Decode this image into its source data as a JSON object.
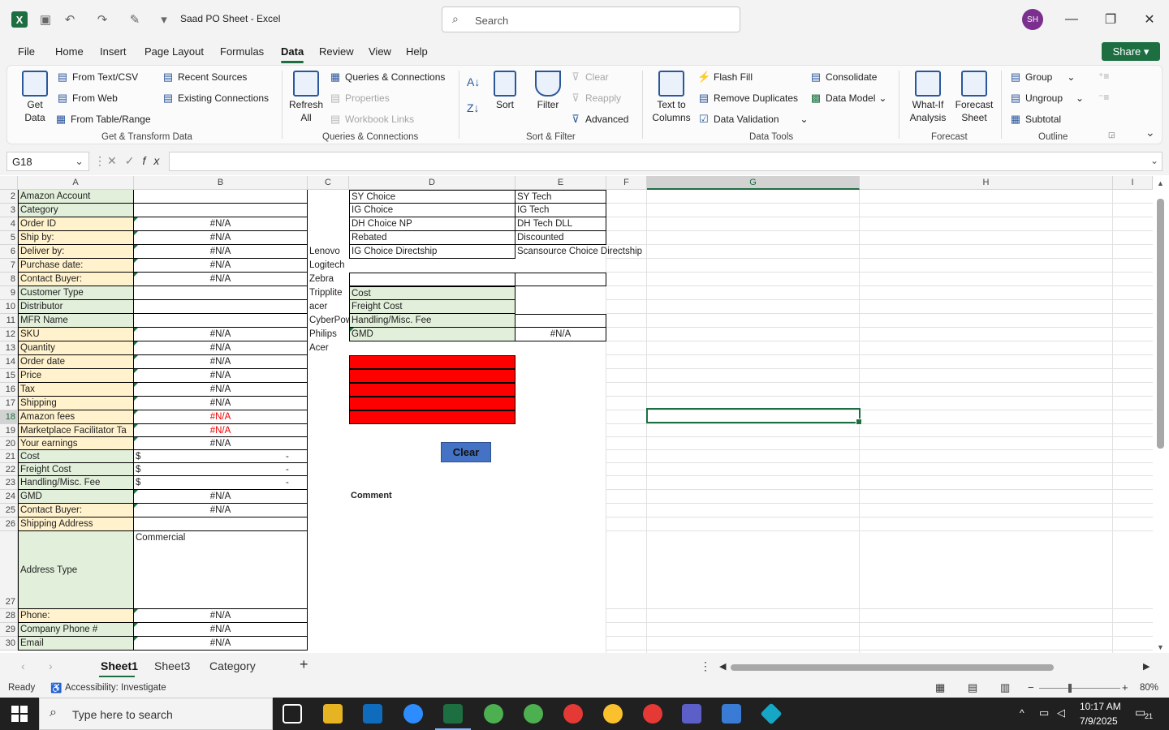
{
  "titlebar": {
    "doc_title": "Saad PO Sheet  -  Excel",
    "search_placeholder": "Search",
    "avatar": "SH"
  },
  "menu": [
    "File",
    "Home",
    "Insert",
    "Page Layout",
    "Formulas",
    "Data",
    "Review",
    "View",
    "Help"
  ],
  "active_menu": "Data",
  "share_label": "Share",
  "ribbon": {
    "get_data": "Get\nData",
    "from_text_csv": "From Text/CSV",
    "from_web": "From Web",
    "from_table_range": "From Table/Range",
    "recent_sources": "Recent Sources",
    "existing_connections": "Existing Connections",
    "group_get_transform": "Get & Transform Data",
    "refresh_all": "Refresh\nAll",
    "queries_connections": "Queries & Connections",
    "properties": "Properties",
    "workbook_links": "Workbook Links",
    "group_queries": "Queries & Connections",
    "sort": "Sort",
    "filter": "Filter",
    "clear": "Clear",
    "reapply": "Reapply",
    "advanced": "Advanced",
    "group_sort_filter": "Sort & Filter",
    "text_to_columns": "Text to\nColumns",
    "flash_fill": "Flash Fill",
    "remove_duplicates": "Remove Duplicates",
    "data_validation": "Data Validation",
    "consolidate": "Consolidate",
    "data_model": "Data Model",
    "group_data_tools": "Data Tools",
    "what_if": "What-If\nAnalysis",
    "forecast_sheet": "Forecast\nSheet",
    "group_forecast": "Forecast",
    "group_btn": "Group",
    "ungroup": "Ungroup",
    "subtotal": "Subtotal",
    "group_outline": "Outline"
  },
  "name_box": "G18",
  "columns": [
    "A",
    "B",
    "C",
    "D",
    "E",
    "F",
    "G",
    "H",
    "I"
  ],
  "selected_column": "G",
  "selected_row": "18",
  "rows_a": [
    {
      "r": "2",
      "label": "Amazon Account",
      "fill": "g",
      "b": ""
    },
    {
      "r": "3",
      "label": "Category",
      "fill": "g",
      "b": ""
    },
    {
      "r": "4",
      "label": "Order ID",
      "fill": "y",
      "b": "#N/A"
    },
    {
      "r": "5",
      "label": "Ship by:",
      "fill": "y",
      "b": "#N/A"
    },
    {
      "r": "6",
      "label": "Deliver by:",
      "fill": "y",
      "b": "#N/A"
    },
    {
      "r": "7",
      "label": "Purchase date:",
      "fill": "y",
      "b": "#N/A"
    },
    {
      "r": "8",
      "label": "Contact Buyer:",
      "fill": "y",
      "b": "#N/A"
    },
    {
      "r": "9",
      "label": "Customer Type",
      "fill": "g",
      "b": ""
    },
    {
      "r": "10",
      "label": "Distributor",
      "fill": "g",
      "b": ""
    },
    {
      "r": "11",
      "label": "MFR Name",
      "fill": "g",
      "b": ""
    },
    {
      "r": "12",
      "label": "SKU",
      "fill": "y",
      "b": "#N/A"
    },
    {
      "r": "13",
      "label": "Quantity",
      "fill": "y",
      "b": "#N/A"
    },
    {
      "r": "14",
      "label": "Order date",
      "fill": "y",
      "b": "#N/A"
    },
    {
      "r": "15",
      "label": "Price",
      "fill": "y",
      "b": "#N/A"
    },
    {
      "r": "16",
      "label": "Tax",
      "fill": "y",
      "b": "#N/A"
    },
    {
      "r": "17",
      "label": "Shipping",
      "fill": "y",
      "b": "#N/A"
    },
    {
      "r": "18",
      "label": "Amazon fees",
      "fill": "y",
      "b": "#N/A"
    },
    {
      "r": "19",
      "label": "Marketplace Facilitator Ta",
      "fill": "y",
      "b": "#N/A"
    },
    {
      "r": "20",
      "label": "Your earnings",
      "fill": "y",
      "b": "#N/A"
    },
    {
      "r": "21",
      "label": "Cost",
      "fill": "g",
      "b": "$"
    },
    {
      "r": "22",
      "label": "Freight Cost",
      "fill": "g",
      "b": "$"
    },
    {
      "r": "23",
      "label": "Handling/Misc. Fee",
      "fill": "g",
      "b": "$"
    },
    {
      "r": "24",
      "label": "GMD",
      "fill": "g",
      "b": "#N/A"
    },
    {
      "r": "25",
      "label": "Contact Buyer:",
      "fill": "y",
      "b": "#N/A"
    },
    {
      "r": "26",
      "label": "Shipping Address",
      "fill": "y",
      "b": ""
    },
    {
      "r": "27",
      "label": "Address Type",
      "fill": "g",
      "b": "Commercial"
    },
    {
      "r": "28",
      "label": "Phone:",
      "fill": "y",
      "b": "#N/A"
    },
    {
      "r": "29",
      "label": "Company Phone #",
      "fill": "g",
      "b": "#N/A"
    },
    {
      "r": "30",
      "label": "Email",
      "fill": "g",
      "b": "#N/A"
    }
  ],
  "dash": "-",
  "col_c": [
    "Lenovo",
    "Logitech",
    "Zebra",
    "Tripplite",
    "acer",
    "CyberPow",
    "Philips",
    "Acer"
  ],
  "col_d": [
    "SY Choice",
    "IG Choice",
    "DH Choice NP",
    " Rebated",
    "IG Choice Directship"
  ],
  "col_e": [
    "SY Tech",
    "IG Tech",
    "DH Tech DLL",
    " Discounted",
    "Scansource Choice Directship"
  ],
  "summary": [
    "Cost",
    "Freight Cost",
    "Handling/Misc. Fee",
    "GMD"
  ],
  "gmd_value": "#N/A",
  "clear_button": "Clear",
  "comment_label": "Comment",
  "sheets": [
    "Sheet1",
    "Sheet3",
    "Category"
  ],
  "active_sheet": "Sheet1",
  "status": {
    "ready": "Ready",
    "accessibility": "Accessibility: Investigate",
    "zoom": "80%"
  },
  "taskbar": {
    "search": "Type here to search",
    "time": "10:17 AM",
    "date": "7/9/2025",
    "notifications": "21"
  }
}
